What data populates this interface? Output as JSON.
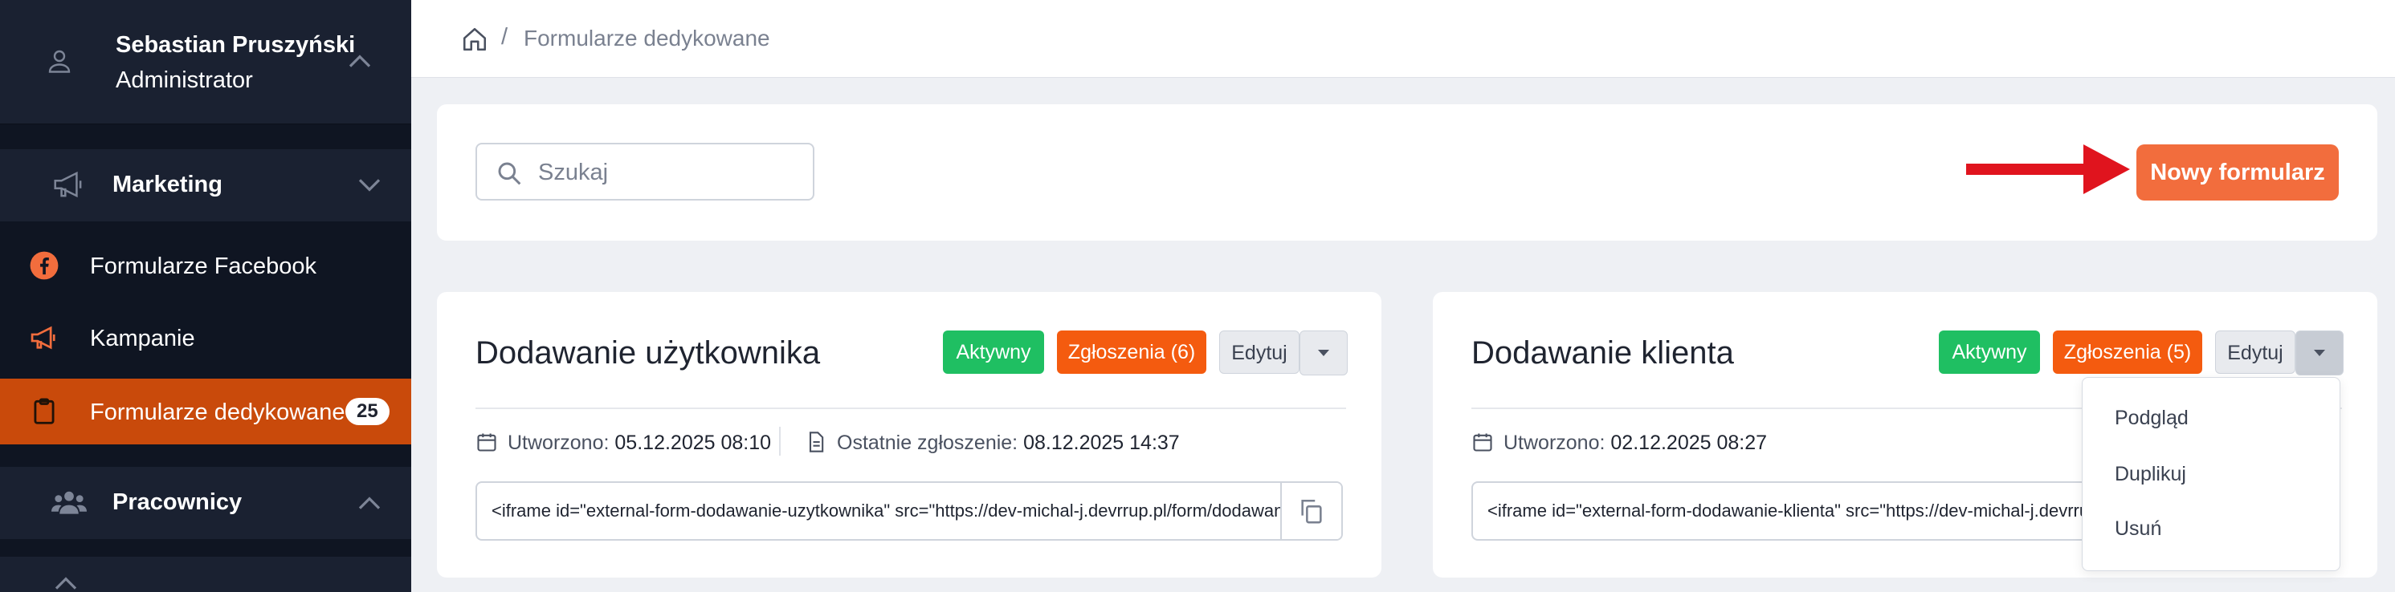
{
  "sidebar": {
    "user": {
      "name": "Sebastian Pruszyński",
      "role": "Administrator"
    },
    "sections": [
      {
        "label": "Marketing",
        "expanded": true
      },
      {
        "label": "Pracownicy",
        "expanded": false
      }
    ],
    "items": [
      {
        "label": "Formularze Facebook",
        "icon": "facebook-icon"
      },
      {
        "label": "Kampanie",
        "icon": "megaphone-icon"
      },
      {
        "label": "Formularze dedykowane",
        "icon": "clipboard-icon",
        "badge": "25",
        "active": true
      }
    ]
  },
  "breadcrumb": {
    "separator": "/",
    "current": "Formularze dedykowane"
  },
  "search": {
    "placeholder": "Szukaj",
    "value": ""
  },
  "new_form_label": "Nowy formularz",
  "forms": [
    {
      "title": "Dodawanie użytkownika",
      "status": "Aktywny",
      "submissions": "Zgłoszenia (6)",
      "edit": "Edytuj",
      "created_label": "Utworzono:",
      "created_value": "05.12.2025 08:10",
      "last_label": "Ostatnie zgłoszenie:",
      "last_value": "08.12.2025 14:37",
      "embed": "<iframe id=\"external-form-dodawanie-uzytkownika\" src=\"https://dev-michal-j.devrrup.pl/form/dodawanie-uzytkownika\"></iframe>"
    },
    {
      "title": "Dodawanie klienta",
      "status": "Aktywny",
      "submissions": "Zgłoszenia (5)",
      "edit": "Edytuj",
      "created_label": "Utworzono:",
      "created_value": "02.12.2025 08:27",
      "embed": "<iframe id=\"external-form-dodawanie-klienta\" src=\"https://dev-michal-j.devrrup.pl/form/dodawanie-klienta\"></iframe>"
    }
  ],
  "dropdown": {
    "items": [
      "Podgląd",
      "Duplikuj",
      "Usuń"
    ]
  },
  "colors": {
    "sidebar_bg": "#0f1522",
    "sidebar_active": "#c94a0b",
    "accent": "#f26d3d",
    "status_green": "#1fbf62",
    "submissions_orange": "#f45b0f",
    "arrow_red": "#e0141e"
  }
}
